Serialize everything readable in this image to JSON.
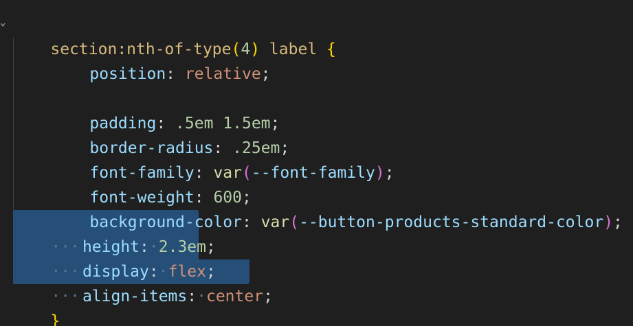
{
  "editor": {
    "header_line": {
      "selector": "section:nth-of-type",
      "open_paren": "(",
      "number": "4",
      "close_paren": ")",
      "tag": " label ",
      "open_brace": "{"
    },
    "lines": [
      {
        "prop": "position",
        "value": "relative",
        "kind": "keyword"
      },
      {
        "prop": "padding",
        "value": ".5em 1.5em",
        "kind": "number"
      },
      {
        "prop": "border-radius",
        "value": ".25em",
        "kind": "number"
      },
      {
        "prop": "font-family",
        "func": "var",
        "arg": "--font-family",
        "kind": "func"
      },
      {
        "prop": "font-weight",
        "value": "600",
        "kind": "number"
      },
      {
        "prop": "background-color",
        "func": "var",
        "arg": "--button-products-standard-color",
        "kind": "func"
      },
      {
        "prop": "height",
        "value": "2.3em",
        "kind": "number"
      },
      {
        "prop": "display",
        "value": "flex",
        "kind": "keyword"
      },
      {
        "prop": "align-items",
        "value": "center",
        "kind": "keyword"
      }
    ],
    "close_brace": "}",
    "colon": ":",
    "semicolon": ";",
    "paren_open": "(",
    "paren_close": ")",
    "whitespace_dots": "···",
    "indent": "    ",
    "colors": {
      "background": "#1f1f1f",
      "selection": "#264f78",
      "property": "#9cdcfe",
      "string_value": "#ce9178",
      "number_value": "#b5cea8",
      "selector": "#d7ba7d",
      "bracket": "#ffd700"
    },
    "icons": {
      "fold": "chevron-down-icon"
    }
  }
}
